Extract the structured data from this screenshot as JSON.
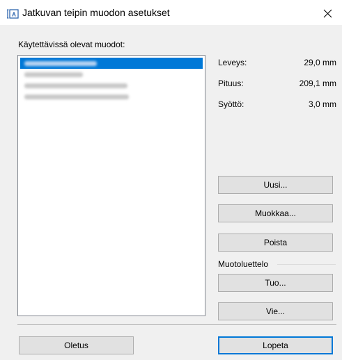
{
  "window": {
    "title": "Jatkuvan teipin muodon asetukset",
    "close_glyph": "✕"
  },
  "list": {
    "label": "Käytettävissä olevat muodot:",
    "items": [
      {
        "selected": true
      },
      {
        "selected": false
      },
      {
        "selected": false
      },
      {
        "selected": false
      }
    ]
  },
  "dimensions": {
    "width_label": "Leveys:",
    "width_value": "29,0 mm",
    "length_label": "Pituus:",
    "length_value": "209,1 mm",
    "feed_label": "Syöttö:",
    "feed_value": "3,0 mm"
  },
  "buttons": {
    "new": "Uusi...",
    "edit": "Muokkaa...",
    "delete": "Poista",
    "import": "Tuo...",
    "export": "Vie...",
    "default": "Oletus",
    "close": "Lopeta"
  },
  "format_list": {
    "label": "Muotoluettelo"
  },
  "colors": {
    "accent": "#0078d7",
    "dialog_bg": "#f0f0f0"
  }
}
